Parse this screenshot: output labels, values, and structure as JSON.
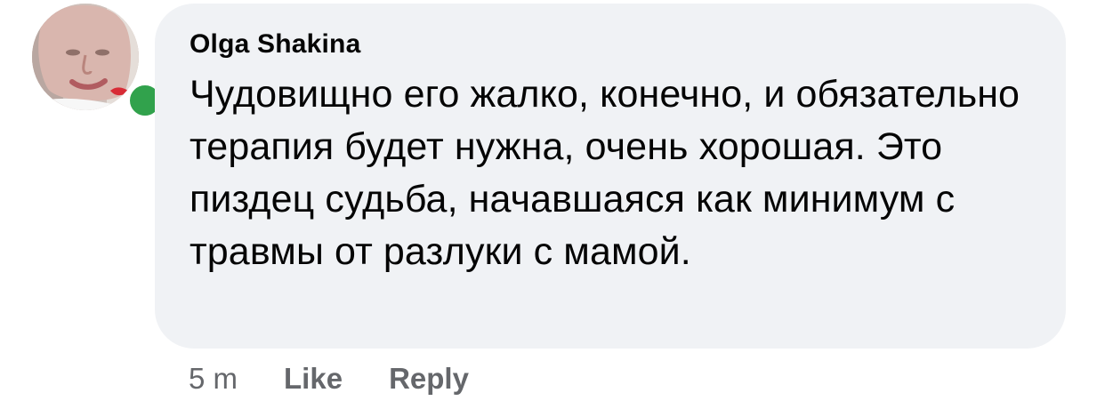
{
  "comment": {
    "author": "Olga Shakina",
    "text": "Чудовищно его жалко, конечно, и обязательно терапия будет нужна, очень хорошая. Это пиздец судьба, начавшаяся как минимум с травмы от разлуки с мамой.",
    "timestamp": "5 m",
    "like_label": "Like",
    "reply_label": "Reply"
  },
  "avatar": {
    "presence": "online",
    "presence_color": "#31a24c"
  },
  "colors": {
    "bubble_background": "#f0f2f5",
    "text": "#050505",
    "secondary_text": "#65676b"
  }
}
